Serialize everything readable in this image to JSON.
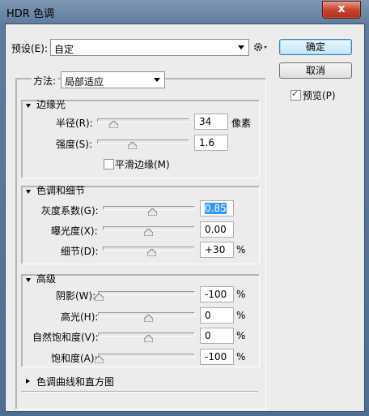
{
  "window": {
    "title": "HDR 色调",
    "close_label": "x"
  },
  "preset": {
    "label": "预设(E):",
    "value": "自定"
  },
  "buttons": {
    "ok": "确定",
    "cancel": "取消"
  },
  "preview": {
    "label": "预览(P)",
    "checked": true
  },
  "method": {
    "label": "方法:",
    "value": "局部适应"
  },
  "edge_glow": {
    "title": "边缘光",
    "radius": {
      "label": "半径(R):",
      "value": "34",
      "unit": "像素"
    },
    "strength": {
      "label": "强度(S):",
      "value": "1.6"
    },
    "smooth_edges": {
      "label": "平滑边缘(M)",
      "checked": false
    }
  },
  "tone_detail": {
    "title": "色调和细节",
    "gamma": {
      "label": "灰度系数(G):",
      "value": "0.85"
    },
    "exposure": {
      "label": "曝光度(X):",
      "value": "0.00"
    },
    "detail": {
      "label": "细节(D):",
      "value": "+30",
      "unit": "%"
    }
  },
  "advanced": {
    "title": "高级",
    "shadow": {
      "label": "阴影(W):",
      "value": "-100",
      "unit": "%"
    },
    "highlight": {
      "label": "高光(H):",
      "value": "0",
      "unit": "%"
    },
    "vibrance": {
      "label": "自然饱和度(V):",
      "value": "0",
      "unit": "%"
    },
    "saturation": {
      "label": "饱和度(A):",
      "value": "-100",
      "unit": "%"
    }
  },
  "curve_section": {
    "title": "色调曲线和直方图"
  }
}
